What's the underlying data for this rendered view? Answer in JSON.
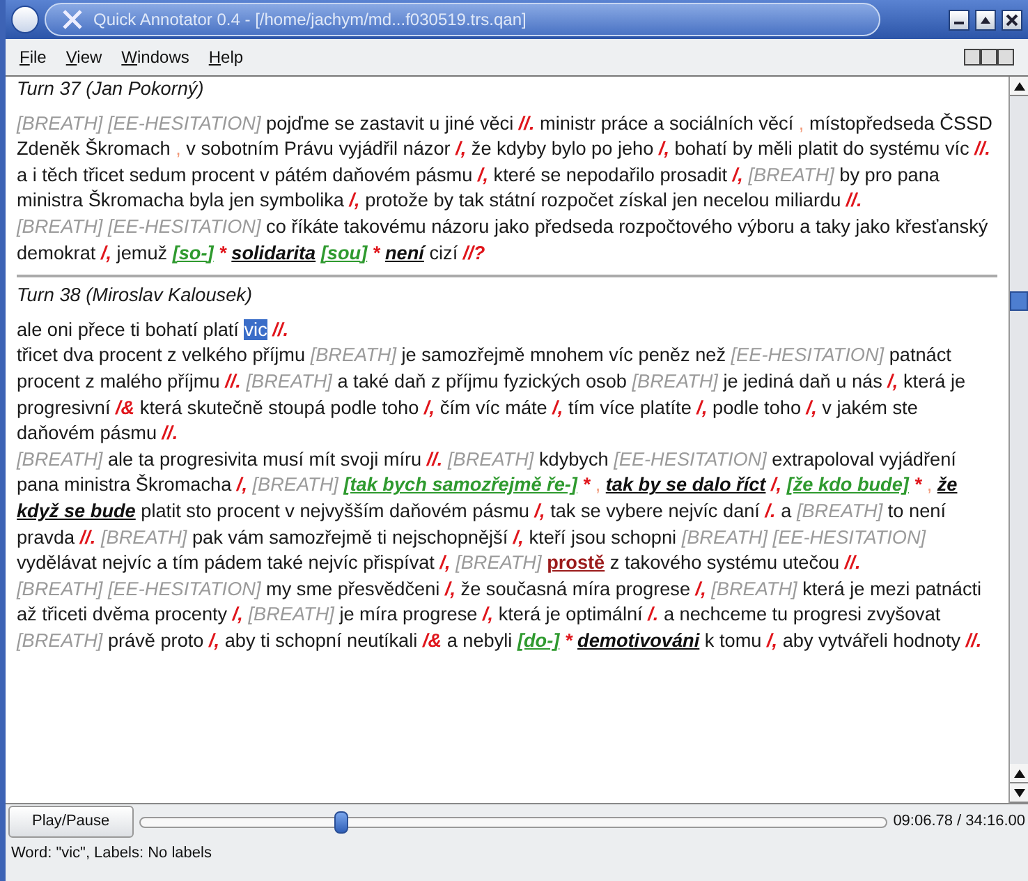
{
  "window": {
    "title": "Quick Annotator 0.4 - [/home/jachym/md...f030519.trs.qan]"
  },
  "menu": [
    {
      "label": "File"
    },
    {
      "label": "View"
    },
    {
      "label": "Windows"
    },
    {
      "label": "Help"
    }
  ],
  "turns": [
    {
      "title": "Turn 37 (Jan Pokorný)",
      "paragraphs": [
        [
          {
            "kind": "tag",
            "text": "[BREATH]"
          },
          {
            "kind": "tag",
            "text": "[EE-HESITATION]"
          },
          {
            "kind": "text",
            "text": "pojďme se zastavit u jiné věci"
          },
          {
            "kind": "boundary",
            "text": "//."
          },
          {
            "kind": "text",
            "text": "ministr práce a sociálních věcí"
          },
          {
            "kind": "noise",
            "text": ","
          },
          {
            "kind": "text",
            "text": "místopředseda ČSSD Zdeněk Škromach"
          },
          {
            "kind": "noise",
            "text": ","
          },
          {
            "kind": "text",
            "text": "v sobotním Právu vyjádřil názor"
          },
          {
            "kind": "boundary",
            "text": "/,"
          },
          {
            "kind": "text",
            "text": "že kdyby bylo po jeho"
          },
          {
            "kind": "boundary",
            "text": "/,"
          },
          {
            "kind": "text",
            "text": "bohatí by měli platit do systému víc"
          },
          {
            "kind": "boundary",
            "text": "//."
          },
          {
            "kind": "text",
            "text": "a i těch třicet sedum procent v pátém daňovém pásmu"
          },
          {
            "kind": "boundary",
            "text": "/,"
          },
          {
            "kind": "text",
            "text": "které se nepodařilo prosadit"
          },
          {
            "kind": "boundary",
            "text": "/,"
          },
          {
            "kind": "tag",
            "text": "[BREATH]"
          },
          {
            "kind": "text",
            "text": "by pro pana ministra Škromacha byla jen symbolika"
          },
          {
            "kind": "boundary",
            "text": "/,"
          },
          {
            "kind": "text",
            "text": "protože by tak státní rozpočet získal jen necelou miliardu"
          },
          {
            "kind": "boundary",
            "text": "//."
          }
        ],
        [
          {
            "kind": "tag",
            "text": "[BREATH]"
          },
          {
            "kind": "tag",
            "text": "[EE-HESITATION]"
          },
          {
            "kind": "text",
            "text": "co říkáte takovému názoru jako předseda rozpočtového výboru a taky jako křesťanský demokrat"
          },
          {
            "kind": "boundary",
            "text": "/,"
          },
          {
            "kind": "text",
            "text": "jemuž"
          },
          {
            "kind": "fragment",
            "text": "[so-]"
          },
          {
            "kind": "boundary",
            "text": "*"
          },
          {
            "kind": "word",
            "text": "solidarita"
          },
          {
            "kind": "fragment",
            "text": "[sou]"
          },
          {
            "kind": "boundary",
            "text": "*"
          },
          {
            "kind": "word",
            "text": "není"
          },
          {
            "kind": "text",
            "text": "cizí"
          },
          {
            "kind": "boundary",
            "text": "//?"
          }
        ]
      ]
    },
    {
      "title": "Turn 38 (Miroslav Kalousek)",
      "paragraphs": [
        [
          {
            "kind": "text",
            "text": "ale oni přece ti bohatí platí"
          },
          {
            "kind": "selected",
            "text": "vic"
          },
          {
            "kind": "boundary",
            "text": "//."
          }
        ],
        [
          {
            "kind": "text",
            "text": "třicet dva procent z velkého příjmu"
          },
          {
            "kind": "tag",
            "text": "[BREATH]"
          },
          {
            "kind": "text",
            "text": "je samozřejmě mnohem víc peněz než"
          },
          {
            "kind": "tag",
            "text": "[EE-HESITATION]"
          },
          {
            "kind": "text",
            "text": "patnáct procent z malého příjmu"
          },
          {
            "kind": "boundary",
            "text": "//."
          },
          {
            "kind": "tag",
            "text": "[BREATH]"
          },
          {
            "kind": "text",
            "text": "a také daň z příjmu fyzických osob"
          },
          {
            "kind": "tag",
            "text": "[BREATH]"
          },
          {
            "kind": "text",
            "text": "je jediná daň u nás"
          },
          {
            "kind": "boundary",
            "text": "/,"
          },
          {
            "kind": "text",
            "text": "která je progresivní"
          },
          {
            "kind": "boundary",
            "text": "/&"
          },
          {
            "kind": "text",
            "text": "která skutečně stoupá podle toho"
          },
          {
            "kind": "boundary",
            "text": "/,"
          },
          {
            "kind": "text",
            "text": "čím víc máte"
          },
          {
            "kind": "boundary",
            "text": "/,"
          },
          {
            "kind": "text",
            "text": "tím více platíte"
          },
          {
            "kind": "boundary",
            "text": "/,"
          },
          {
            "kind": "text",
            "text": "podle toho"
          },
          {
            "kind": "boundary",
            "text": "/,"
          },
          {
            "kind": "text",
            "text": "v jakém ste daňovém pásmu"
          },
          {
            "kind": "boundary",
            "text": "//."
          }
        ],
        [
          {
            "kind": "tag",
            "text": "[BREATH]"
          },
          {
            "kind": "text",
            "text": "ale ta progresivita musí mít svoji míru"
          },
          {
            "kind": "boundary",
            "text": "//."
          },
          {
            "kind": "tag",
            "text": "[BREATH]"
          },
          {
            "kind": "text",
            "text": "kdybych"
          },
          {
            "kind": "tag",
            "text": "[EE-HESITATION]"
          },
          {
            "kind": "text",
            "text": "extrapoloval vyjádření pana ministra Škromacha"
          },
          {
            "kind": "boundary",
            "text": "/,"
          },
          {
            "kind": "tag",
            "text": "[BREATH]"
          },
          {
            "kind": "fragment",
            "text": "[tak bych samozřejmě ře-]"
          },
          {
            "kind": "boundary",
            "text": "*"
          },
          {
            "kind": "noise",
            "text": ","
          },
          {
            "kind": "word",
            "text": "tak by se dalo říct"
          },
          {
            "kind": "boundary",
            "text": "/,"
          },
          {
            "kind": "fragment",
            "text": "[že kdo bude]"
          },
          {
            "kind": "boundary",
            "text": "*"
          },
          {
            "kind": "noise",
            "text": ","
          },
          {
            "kind": "word",
            "text": "že když se bude"
          },
          {
            "kind": "text",
            "text": "platit sto procent v nejvyšším daňovém pásmu"
          },
          {
            "kind": "boundary",
            "text": "/,"
          },
          {
            "kind": "text",
            "text": "tak se vybere nejvíc daní"
          },
          {
            "kind": "boundary",
            "text": "/."
          },
          {
            "kind": "text",
            "text": "a"
          },
          {
            "kind": "tag",
            "text": "[BREATH]"
          },
          {
            "kind": "text",
            "text": "to není pravda"
          },
          {
            "kind": "boundary",
            "text": "//."
          },
          {
            "kind": "tag",
            "text": "[BREATH]"
          },
          {
            "kind": "text",
            "text": "pak vám samozřejmě ti nejschopnější"
          },
          {
            "kind": "boundary",
            "text": "/,"
          },
          {
            "kind": "text",
            "text": "kteří jsou schopni"
          },
          {
            "kind": "tag",
            "text": "[BREATH]"
          },
          {
            "kind": "tag",
            "text": "[EE-HESITATION]"
          },
          {
            "kind": "text",
            "text": "vydělávat nejvíc a tím pádem také nejvíc přispívat"
          },
          {
            "kind": "boundary",
            "text": "/,"
          },
          {
            "kind": "tag",
            "text": "[BREATH]"
          },
          {
            "kind": "emphasis",
            "text": "prostě"
          },
          {
            "kind": "text",
            "text": "z takového systému utečou"
          },
          {
            "kind": "boundary",
            "text": "//."
          }
        ],
        [
          {
            "kind": "tag",
            "text": "[BREATH]"
          },
          {
            "kind": "tag",
            "text": "[EE-HESITATION]"
          },
          {
            "kind": "text",
            "text": "my sme přesvědčeni"
          },
          {
            "kind": "boundary",
            "text": "/,"
          },
          {
            "kind": "text",
            "text": "že současná míra progrese"
          },
          {
            "kind": "boundary",
            "text": "/,"
          },
          {
            "kind": "tag",
            "text": "[BREATH]"
          },
          {
            "kind": "text",
            "text": "která je mezi patnácti až třiceti dvěma procenty"
          },
          {
            "kind": "boundary",
            "text": "/,"
          },
          {
            "kind": "tag",
            "text": "[BREATH]"
          },
          {
            "kind": "text",
            "text": "je míra progrese"
          },
          {
            "kind": "boundary",
            "text": "/,"
          },
          {
            "kind": "text",
            "text": "která je optimální"
          },
          {
            "kind": "boundary",
            "text": "/."
          },
          {
            "kind": "text",
            "text": "a nechceme tu progresi zvyšovat"
          },
          {
            "kind": "tag",
            "text": "[BREATH]"
          },
          {
            "kind": "text",
            "text": "právě proto"
          },
          {
            "kind": "boundary",
            "text": "/,"
          },
          {
            "kind": "text",
            "text": "aby ti schopní neutíkali"
          },
          {
            "kind": "boundary",
            "text": "/&"
          },
          {
            "kind": "text",
            "text": "a nebyli"
          },
          {
            "kind": "fragment",
            "text": "[do-]"
          },
          {
            "kind": "boundary",
            "text": "*"
          },
          {
            "kind": "word",
            "text": "demotivováni"
          },
          {
            "kind": "text",
            "text": "k tomu"
          },
          {
            "kind": "boundary",
            "text": "/,"
          },
          {
            "kind": "text",
            "text": "aby vytvářeli hodnoty"
          },
          {
            "kind": "boundary",
            "text": "//."
          }
        ]
      ]
    }
  ],
  "player": {
    "button": "Play/Pause",
    "level": 0.27,
    "time": "09:06.78 / 34:16.00"
  },
  "status_bar": "Word: \"vic\", Labels: No labels"
}
